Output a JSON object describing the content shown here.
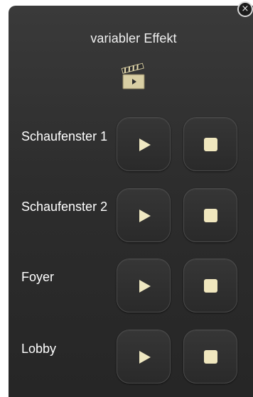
{
  "widget": {
    "title": "variabler Effekt",
    "icon": "clapperboard-icon",
    "close_glyph": "×"
  },
  "rows": [
    {
      "label": "Schaufenster 1",
      "play_icon": "play-icon",
      "stop_icon": "stop-icon"
    },
    {
      "label": "Schaufenster 2",
      "play_icon": "play-icon",
      "stop_icon": "stop-icon"
    },
    {
      "label": "Foyer",
      "play_icon": "play-icon",
      "stop_icon": "stop-icon"
    },
    {
      "label": "Lobby",
      "play_icon": "play-icon",
      "stop_icon": "stop-icon"
    }
  ],
  "colors": {
    "panel_background": "#2d2d2d",
    "text": "#ffffff",
    "button_glyph": "#efe8c2"
  }
}
